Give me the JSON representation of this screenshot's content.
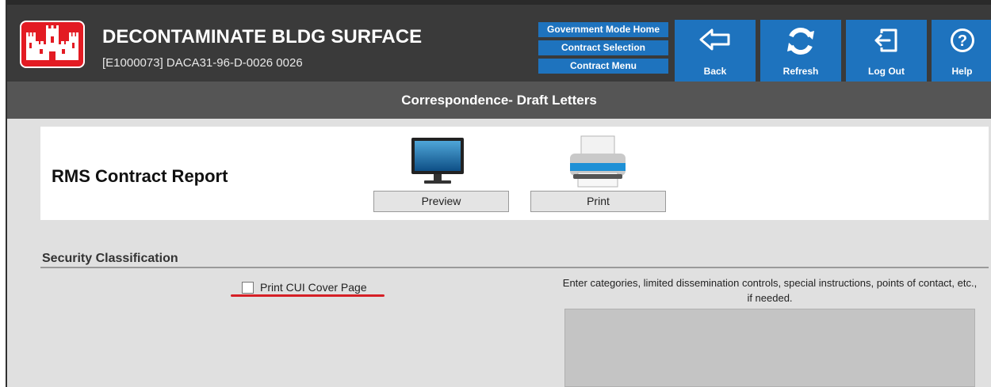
{
  "header": {
    "title": "DECONTAMINATE BLDG SURFACE",
    "subtitle": "[E1000073] DACA31-96-D-0026 0026",
    "logo_icon": "usace-castle-logo",
    "nav_links": [
      "Government Mode Home",
      "Contract Selection",
      "Contract Menu"
    ],
    "tools": [
      {
        "label": "Back",
        "icon": "arrow-left-icon"
      },
      {
        "label": "Refresh",
        "icon": "refresh-icon"
      },
      {
        "label": "Log Out",
        "icon": "logout-icon"
      },
      {
        "label": "Help",
        "icon": "help-icon"
      }
    ],
    "accent_color": "#1e73be",
    "logo_color": "#e31b23"
  },
  "page_title": "Correspondence- Draft Letters",
  "report": {
    "title": "RMS Contract Report",
    "preview_label": "Preview",
    "print_label": "Print"
  },
  "security": {
    "heading": "Security Classification",
    "cui_label": "Print CUI Cover Page",
    "cui_checked": false,
    "instructions": "Enter categories, limited dissemination controls, special instructions, points of contact, etc., if needed.",
    "instructions_value": ""
  }
}
